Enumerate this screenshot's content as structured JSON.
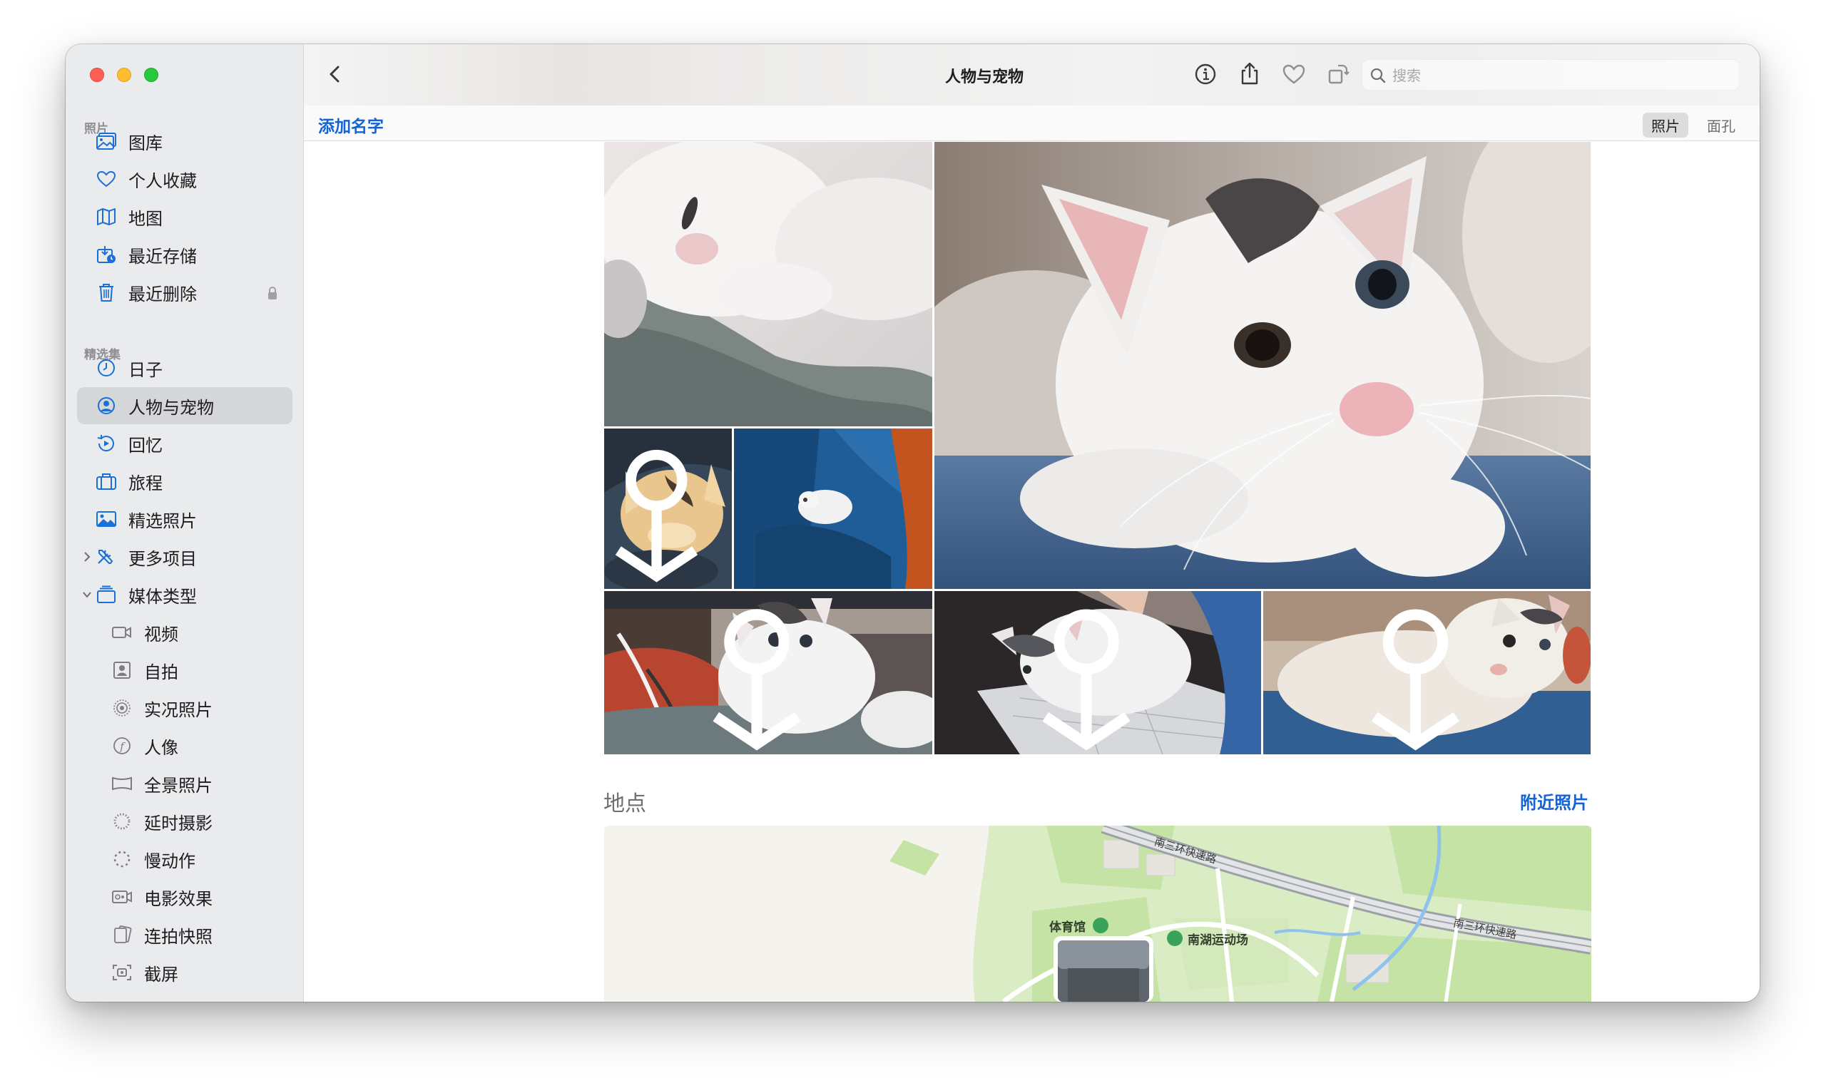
{
  "window": {
    "title": "人物与宠物",
    "traffic_lights": [
      "close",
      "minimize",
      "zoom"
    ]
  },
  "sidebar": {
    "section_photos": "照片",
    "items_photos": [
      {
        "label": "图库",
        "icon": "photo-library-icon"
      },
      {
        "label": "个人收藏",
        "icon": "heart-icon"
      },
      {
        "label": "地图",
        "icon": "map-icon"
      },
      {
        "label": "最近存储",
        "icon": "recent-save-icon"
      },
      {
        "label": "最近删除",
        "icon": "trash-icon",
        "locked": true
      }
    ],
    "section_collections": "精选集",
    "items_collections": [
      {
        "label": "日子",
        "icon": "clock-icon"
      },
      {
        "label": "人物与宠物",
        "icon": "person-circle-icon",
        "selected": true
      },
      {
        "label": "回忆",
        "icon": "memories-icon"
      },
      {
        "label": "旅程",
        "icon": "suitcase-icon"
      },
      {
        "label": "精选照片",
        "icon": "featured-photo-icon"
      },
      {
        "label": "更多项目",
        "icon": "tools-icon",
        "disclosure": "collapsed"
      },
      {
        "label": "媒体类型",
        "icon": "stack-icon",
        "disclosure": "expanded"
      }
    ],
    "items_media": [
      {
        "label": "视频",
        "icon": "video-icon"
      },
      {
        "label": "自拍",
        "icon": "selfie-icon"
      },
      {
        "label": "实况照片",
        "icon": "live-photo-icon"
      },
      {
        "label": "人像",
        "icon": "portrait-icon"
      },
      {
        "label": "全景照片",
        "icon": "panorama-icon"
      },
      {
        "label": "延时摄影",
        "icon": "timelapse-icon"
      },
      {
        "label": "慢动作",
        "icon": "slomo-icon"
      },
      {
        "label": "电影效果",
        "icon": "cinematic-icon"
      },
      {
        "label": "连拍快照",
        "icon": "burst-icon"
      },
      {
        "label": "截屏",
        "icon": "screenshot-icon"
      }
    ]
  },
  "toolbar": {
    "back_icon": "chevron-left-icon",
    "info_icon": "info-icon",
    "share_icon": "share-icon",
    "favorite_icon": "heart-icon",
    "rotate_icon": "rotate-icon",
    "search_placeholder": "搜索"
  },
  "subbar": {
    "add_name": "添加名字",
    "segments": [
      {
        "label": "照片",
        "active": true
      },
      {
        "label": "面孔",
        "active": false
      }
    ]
  },
  "content": {
    "places_title": "地点",
    "nearby_link": "附近照片",
    "map": {
      "road_labels": [
        "南三环快速路",
        "南三环快速路"
      ],
      "poi_labels": [
        "体育馆",
        "南湖运动场"
      ]
    }
  },
  "colors": {
    "accent": "#1463d6",
    "sidebar_bg": "#e9ebec",
    "selected_bg": "#d4d6d8",
    "map_green": "#c5e3a4",
    "map_base": "#f5f3ee"
  }
}
